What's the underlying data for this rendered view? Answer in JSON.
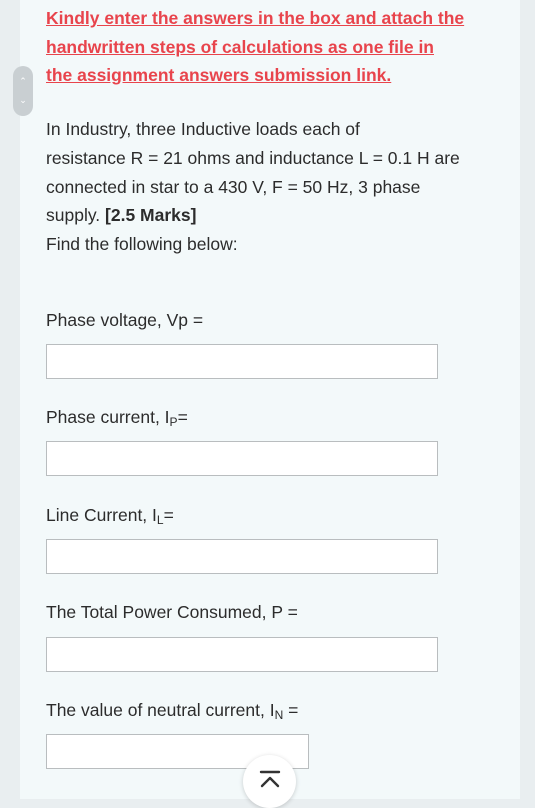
{
  "notice": {
    "line1": "Kindly enter the answers in the box and attach the",
    "line2": "handwritten steps of calculations as one file in",
    "line3": "the assignment answers submission link."
  },
  "question": {
    "line1": "In Industry, three Inductive loads each of",
    "line2": "resistance R = 21 ohms and inductance L = 0.1 H are",
    "line3": "connected in star to a 430 V, F = 50 Hz, 3 phase",
    "line4_text": "supply.",
    "marks": "[2.5 Marks]",
    "instruction": "Find the following below:"
  },
  "fields": {
    "phase_voltage": {
      "label": "Phase voltage, Vp =",
      "value": ""
    },
    "phase_current": {
      "label_main": "Phase current, I",
      "label_sub": "P",
      "label_end": "=",
      "value": ""
    },
    "line_current": {
      "label_main": "Line Current, I",
      "label_sub": "L",
      "label_end": "=",
      "value": ""
    },
    "total_power": {
      "label": "The Total Power Consumed, P =",
      "value": ""
    },
    "neutral_current": {
      "label_main": "The value of neutral current, I",
      "label_sub": "N",
      "label_end": " =",
      "value": ""
    }
  },
  "icons": {
    "side_scroller": "up-down-chevrons-icon",
    "scroll_top": "scroll-to-top-icon"
  },
  "colors": {
    "notice": "#e8444c",
    "text": "#2c2c2c",
    "panel": "#f3f9fa",
    "background": "#e9eef0"
  }
}
